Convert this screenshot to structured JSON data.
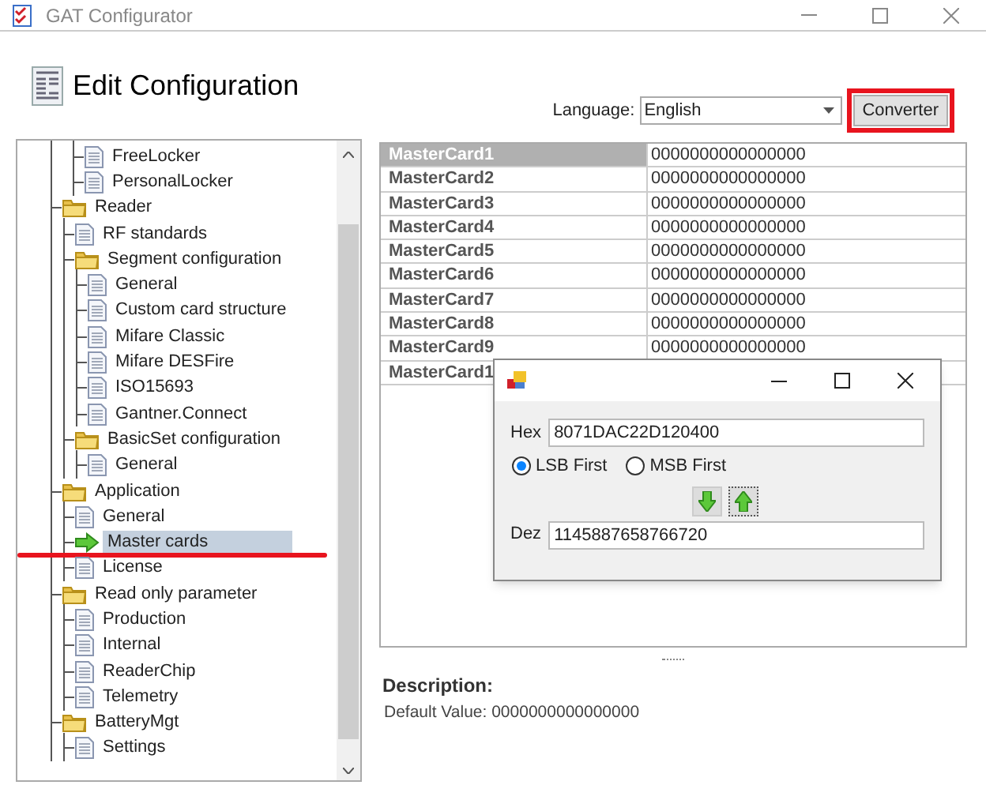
{
  "window": {
    "title": "GAT Configurator"
  },
  "header": {
    "title": "Edit Configuration",
    "language_label": "Language:",
    "language_value": "English",
    "converter_button": "Converter"
  },
  "tree": {
    "continued_items": [
      {
        "label": "FreeLocker",
        "kind": "page",
        "selected": false
      },
      {
        "label": "PersonalLocker",
        "kind": "page",
        "selected": false
      }
    ],
    "items": [
      {
        "label": "Reader",
        "kind": "folder",
        "selected": false,
        "children": [
          {
            "label": "RF standards",
            "kind": "page",
            "selected": false
          },
          {
            "label": "Segment configuration",
            "kind": "folder",
            "selected": false,
            "children": [
              {
                "label": "General",
                "kind": "page",
                "selected": false
              },
              {
                "label": "Custom card structure",
                "kind": "page",
                "selected": false
              },
              {
                "label": "Mifare Classic",
                "kind": "page",
                "selected": false
              },
              {
                "label": "Mifare DESFire",
                "kind": "page",
                "selected": false
              },
              {
                "label": "ISO15693",
                "kind": "page",
                "selected": false
              },
              {
                "label": "Gantner.Connect",
                "kind": "page",
                "selected": false
              }
            ]
          },
          {
            "label": "BasicSet configuration",
            "kind": "folder",
            "selected": false,
            "children": [
              {
                "label": "General",
                "kind": "page",
                "selected": false
              }
            ]
          }
        ]
      },
      {
        "label": "Application",
        "kind": "folder",
        "selected": false,
        "children": [
          {
            "label": "General",
            "kind": "page",
            "selected": false
          },
          {
            "label": "Master cards",
            "kind": "arrow",
            "selected": true
          },
          {
            "label": "License",
            "kind": "page",
            "selected": false
          }
        ]
      },
      {
        "label": "Read only parameter",
        "kind": "folder",
        "selected": false,
        "children": [
          {
            "label": "Production",
            "kind": "page",
            "selected": false
          },
          {
            "label": "Internal",
            "kind": "page",
            "selected": false
          },
          {
            "label": "ReaderChip",
            "kind": "page",
            "selected": false
          },
          {
            "label": "Telemetry",
            "kind": "page",
            "selected": false
          }
        ]
      },
      {
        "label": "BatteryMgt",
        "kind": "folder",
        "selected": false,
        "children": [
          {
            "label": "Settings",
            "kind": "page",
            "selected": false
          }
        ]
      }
    ]
  },
  "table": {
    "rows": [
      {
        "name": "MasterCard1",
        "value": "0000000000000000",
        "selected": true
      },
      {
        "name": "MasterCard2",
        "value": "0000000000000000",
        "selected": false
      },
      {
        "name": "MasterCard3",
        "value": "0000000000000000",
        "selected": false
      },
      {
        "name": "MasterCard4",
        "value": "0000000000000000",
        "selected": false
      },
      {
        "name": "MasterCard5",
        "value": "0000000000000000",
        "selected": false
      },
      {
        "name": "MasterCard6",
        "value": "0000000000000000",
        "selected": false
      },
      {
        "name": "MasterCard7",
        "value": "0000000000000000",
        "selected": false
      },
      {
        "name": "MasterCard8",
        "value": "0000000000000000",
        "selected": false
      },
      {
        "name": "MasterCard9",
        "value": "0000000000000000",
        "selected": false
      },
      {
        "name": "MasterCard1",
        "selected": false
      }
    ]
  },
  "description": {
    "title": "Description:",
    "text": "Default Value: 0000000000000000"
  },
  "converter_dialog": {
    "hex_label": "Hex",
    "hex_value": "8071DAC22D120400",
    "byte_order": [
      {
        "label": "LSB First",
        "selected": true
      },
      {
        "label": "MSB First",
        "selected": false
      }
    ],
    "dez_label": "Dez",
    "dez_value": "1145887658766720"
  }
}
